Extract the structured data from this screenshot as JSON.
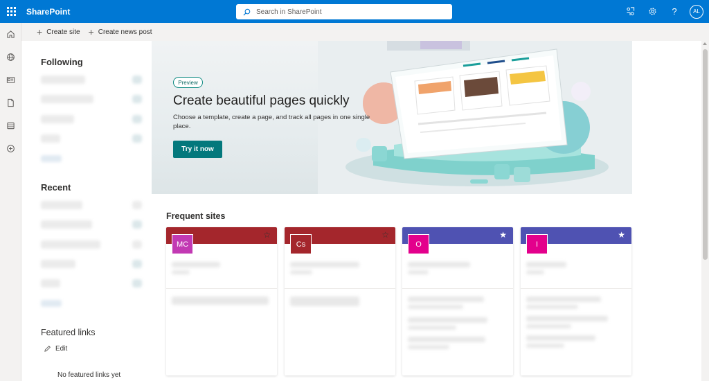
{
  "suite": {
    "brand": "SharePoint",
    "search_placeholder": "Search in SharePoint",
    "help_label": "?",
    "avatar_initials": "AL",
    "accent": "#0078d4"
  },
  "appbar": {
    "icons": [
      "home-icon",
      "globe-icon",
      "news-icon",
      "document-icon",
      "lists-icon",
      "create-icon"
    ]
  },
  "commandbar": {
    "create_site": "Create site",
    "create_news": "Create news post"
  },
  "left_panel": {
    "following_title": "Following",
    "recent_title": "Recent",
    "featured_title": "Featured links",
    "edit_label": "Edit",
    "no_links_text": "No featured links yet"
  },
  "hero": {
    "badge": "Preview",
    "title": "Create beautiful pages quickly",
    "description": "Choose a template, create a page, and track all pages in one single place.",
    "cta": "Try it now",
    "cta_color": "#03787c"
  },
  "frequent_sites": {
    "title": "Frequent sites",
    "cards": [
      {
        "initials": "MC",
        "band_color": "#a4262c",
        "logo_color": "#c239b3",
        "starred": false
      },
      {
        "initials": "Cs",
        "band_color": "#a4262c",
        "logo_color": "#a4262c",
        "starred": false
      },
      {
        "initials": "O",
        "band_color": "#4f52b2",
        "logo_color": "#e3008c",
        "starred": true
      },
      {
        "initials": "I",
        "band_color": "#4f52b2",
        "logo_color": "#e3008c",
        "starred": true
      }
    ]
  }
}
